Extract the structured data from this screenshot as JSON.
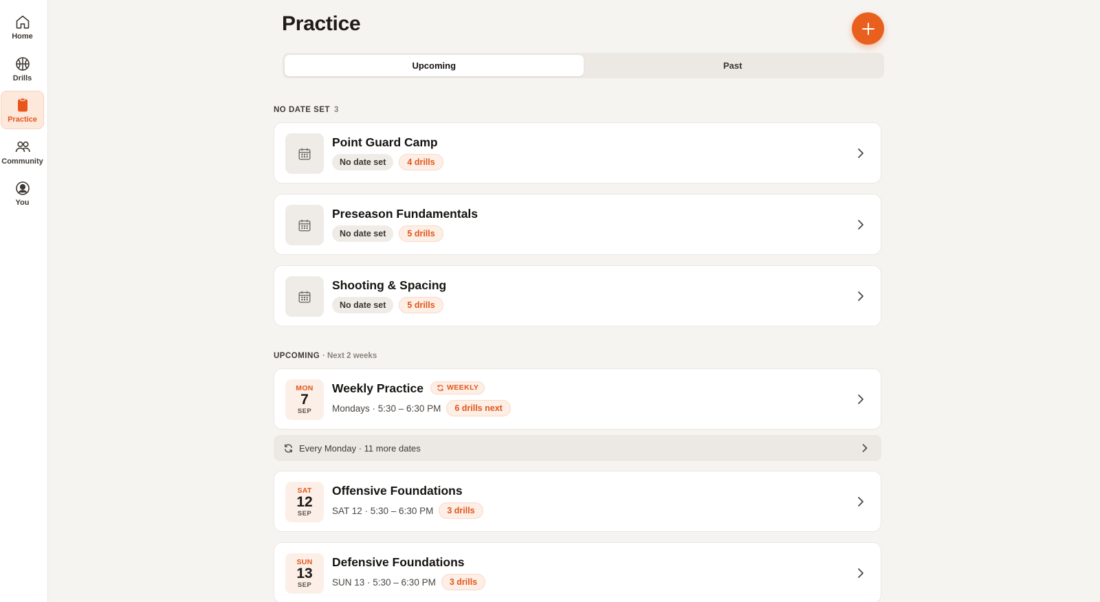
{
  "sidebar": {
    "items": [
      {
        "label": "Home",
        "icon": "home-icon"
      },
      {
        "label": "Drills",
        "icon": "basketball-icon"
      },
      {
        "label": "Practice",
        "icon": "clipboard-icon",
        "active": true
      },
      {
        "label": "Community",
        "icon": "people-icon"
      },
      {
        "label": "You",
        "icon": "user-circle-icon"
      }
    ]
  },
  "header": {
    "title": "Practice",
    "add_icon": "plus-icon"
  },
  "tabs": [
    {
      "label": "Upcoming",
      "active": true
    },
    {
      "label": "Past",
      "active": false
    }
  ],
  "no_date_section": {
    "label": "NO DATE SET",
    "count": "3",
    "items": [
      {
        "title": "Point Guard Camp",
        "date_label": "No date set",
        "drills": "4 drills"
      },
      {
        "title": "Preseason Fundamentals",
        "date_label": "No date set",
        "drills": "5 drills"
      },
      {
        "title": "Shooting & Spacing",
        "date_label": "No date set",
        "drills": "5 drills"
      }
    ]
  },
  "upcoming_section": {
    "label": "UPCOMING",
    "sub": "· Next 2 weeks",
    "items": [
      {
        "dow": "MON",
        "day": "7",
        "month": "SEP",
        "title": "Weekly Practice",
        "badge": "WEEKLY",
        "schedule": "Mondays · 5:30 – 6:30 PM",
        "drills": "6 drills next"
      },
      {
        "dow": "SAT",
        "day": "12",
        "month": "SEP",
        "title": "Offensive Foundations",
        "schedule": "SAT 12 · 5:30 – 6:30 PM",
        "drills": "3 drills"
      },
      {
        "dow": "SUN",
        "day": "13",
        "month": "SEP",
        "title": "Defensive Foundations",
        "schedule": "SUN 13 · 5:30 – 6:30 PM",
        "drills": "3 drills"
      }
    ],
    "recurrence": "Every Monday · 11 more dates"
  },
  "colors": {
    "accent": "#e95f1e",
    "background": "#f6f4f1",
    "card": "#ffffff"
  }
}
